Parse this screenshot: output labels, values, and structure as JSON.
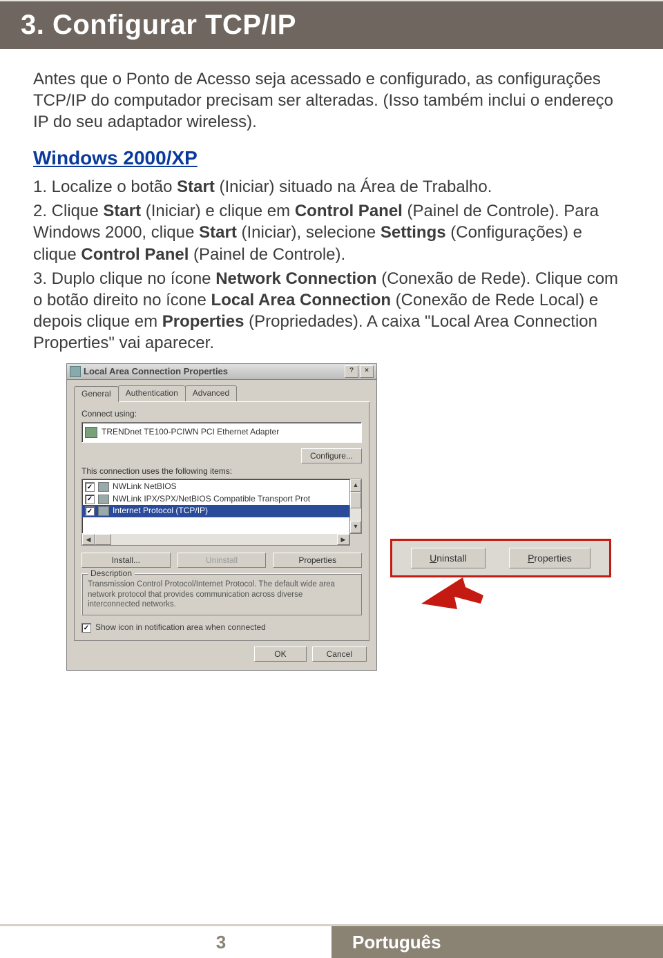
{
  "header": {
    "title": "3. Configurar TCP/IP"
  },
  "intro": {
    "p1": "Antes que o Ponto de Acesso seja acessado e configurado, as configurações TCP/IP do computador precisam ser alteradas. (Isso também inclui o endereço IP do seu adaptador wireless)."
  },
  "section_heading": "Windows 2000/XP",
  "steps": {
    "s1_a": "1. Localize o botão ",
    "s1_b": "Start",
    "s1_c": " (Iniciar) situado na Área de Trabalho.",
    "s2_a": "2. Clique ",
    "s2_b": "Start",
    "s2_c": " (Iniciar) e clique em ",
    "s2_d": "Control Panel",
    "s2_e": " (Painel de Controle). Para Windows 2000, clique ",
    "s2_f": "Start",
    "s2_g": " (Iniciar), selecione ",
    "s2_h": "Settings",
    "s2_i": " (Configurações) e clique ",
    "s2_j": "Control Panel",
    "s2_k": " (Painel de Controle).",
    "s3_a": "3. Duplo clique no ícone ",
    "s3_b": "Network Connection",
    "s3_c": " (Conexão de Rede). Clique com o botão direito no ícone ",
    "s3_d": "Local Area Connection",
    "s3_e": " (Conexão de Rede Local) e depois clique em ",
    "s3_f": "Properties",
    "s3_g": " (Propriedades). A caixa \"Local Area Connection Properties\" vai aparecer."
  },
  "dialog": {
    "title": "Local Area Connection Properties",
    "tabs": {
      "general": "General",
      "auth": "Authentication",
      "advanced": "Advanced"
    },
    "connect_using": "Connect using:",
    "adapter": "TRENDnet TE100-PCIWN PCI Ethernet Adapter",
    "configure": "Configure...",
    "uses_items": "This connection uses the following items:",
    "list": {
      "item1": "NWLink NetBIOS",
      "item2": "NWLink IPX/SPX/NetBIOS Compatible Transport Prot",
      "item3": "Internet Protocol (TCP/IP)"
    },
    "install": "Install...",
    "uninstall": "Uninstall",
    "properties": "Properties",
    "desc_legend": "Description",
    "desc_text": "Transmission Control Protocol/Internet Protocol. The default wide area network protocol that provides communication across diverse interconnected networks.",
    "show_icon": "Show icon in notification area when connected",
    "ok": "OK",
    "cancel": "Cancel"
  },
  "callout": {
    "uninstall_u": "U",
    "uninstall_rest": "ninstall",
    "properties_p": "P",
    "properties_rest": "roperties"
  },
  "footer": {
    "page": "3",
    "language": "Português"
  }
}
